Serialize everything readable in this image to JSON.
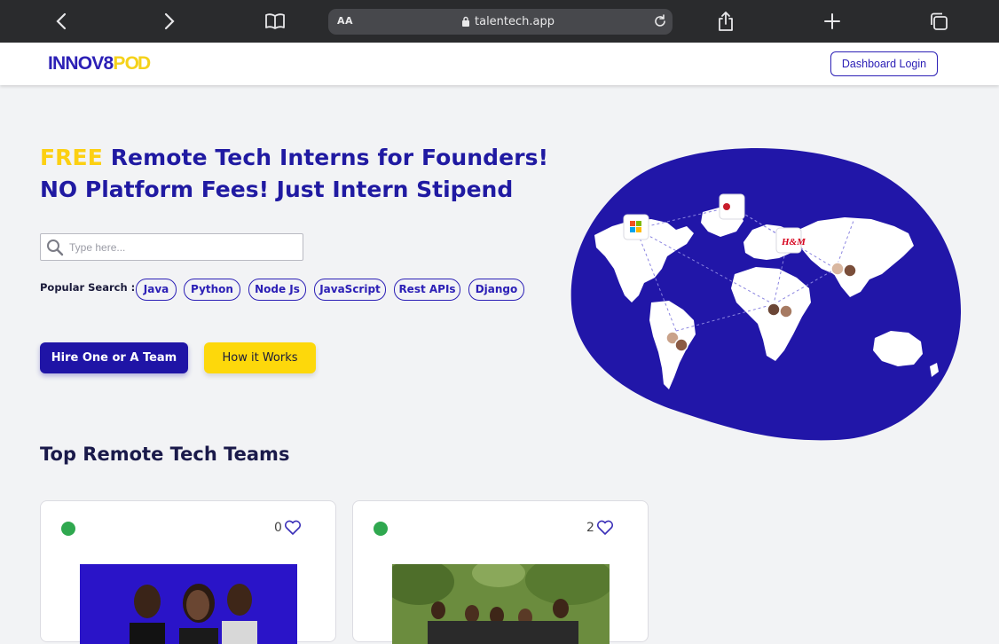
{
  "browser": {
    "url": "talentech.app",
    "aa_label": "AA"
  },
  "nav": {
    "logo_text_a": "INNOV8",
    "logo_text_b": "P",
    "logo_text_c": "OD",
    "dashboard_login": "Dashboard Login"
  },
  "hero": {
    "free": "FREE",
    "line1_rest": " Remote Tech Interns for Founders!",
    "line2": "NO Platform Fees! Just Intern Stipend",
    "search_placeholder": "Type here...",
    "popular_label": "Popular Search :",
    "chips": [
      "Java",
      "Python",
      "Node Js",
      "JavaScript",
      "Rest APIs",
      "Django"
    ],
    "hire_button": "Hire One or A Team",
    "how_button": "How it Works"
  },
  "map": {
    "companies": [
      "Microsoft",
      "Swiftlr",
      "H&M"
    ]
  },
  "teams": {
    "heading": "Top Remote Tech Teams",
    "cards": [
      {
        "likes": "0",
        "status_color": "#2fa84f"
      },
      {
        "likes": "2",
        "status_color": "#2fa84f"
      }
    ]
  },
  "colors": {
    "brand": "#201aa2",
    "accent": "#fdd80b",
    "online": "#2fa84f"
  }
}
